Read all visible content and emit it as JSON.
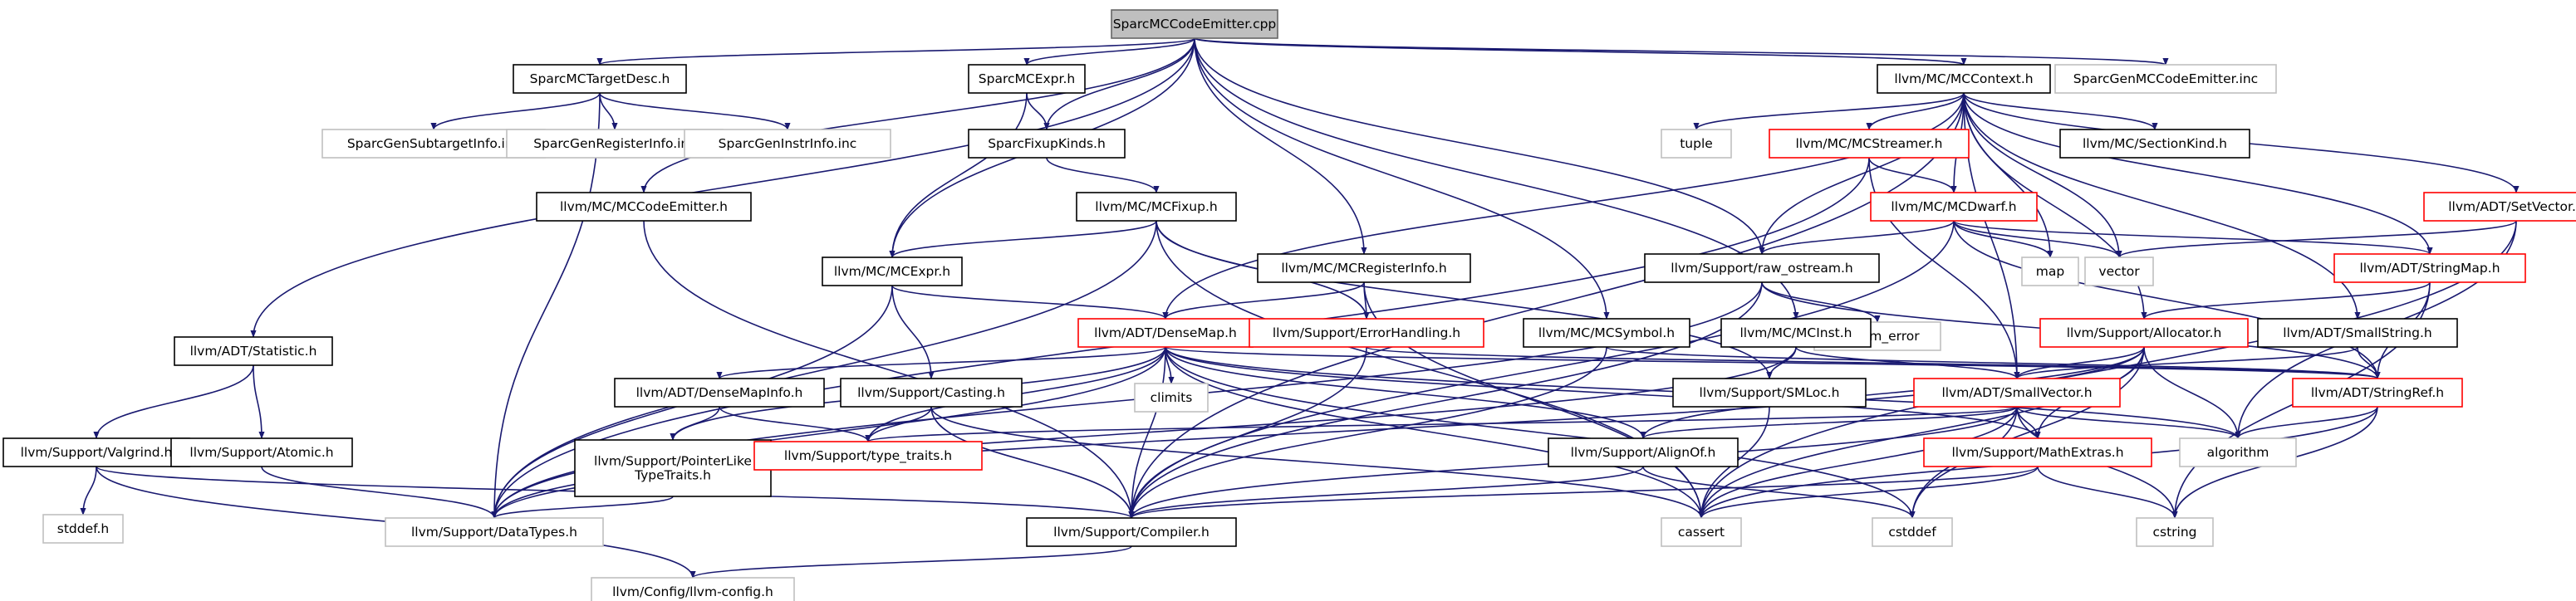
{
  "diagram": {
    "colors": {
      "edge": "#191970",
      "edge_external": "#9a9a9a",
      "border_root": "#666666",
      "fill_root": "#bfbfbf",
      "border_normal": "#000000",
      "border_incomplete": "#ff0000",
      "border_external": "#bfbfbf"
    },
    "nodes": [
      {
        "id": "root",
        "label": "SparcMCCodeEmitter.cpp",
        "kind": "root"
      },
      {
        "id": "targetdesc",
        "label": "SparcMCTargetDesc.h",
        "kind": "normal"
      },
      {
        "id": "sparcexpr",
        "label": "SparcMCExpr.h",
        "kind": "normal"
      },
      {
        "id": "mccontext",
        "label": "llvm/MC/MCContext.h",
        "kind": "normal"
      },
      {
        "id": "gencodeemitter",
        "label": "SparcGenMCCodeEmitter.inc",
        "kind": "external"
      },
      {
        "id": "gensubtarget",
        "label": "SparcGenSubtargetInfo.inc",
        "kind": "external"
      },
      {
        "id": "genregister",
        "label": "SparcGenRegisterInfo.inc",
        "kind": "external"
      },
      {
        "id": "geninstr",
        "label": "SparcGenInstrInfo.inc",
        "kind": "external"
      },
      {
        "id": "fixupkinds",
        "label": "SparcFixupKinds.h",
        "kind": "normal"
      },
      {
        "id": "tuple",
        "label": "tuple",
        "kind": "external"
      },
      {
        "id": "mcstreamer",
        "label": "llvm/MC/MCStreamer.h",
        "kind": "incomplete"
      },
      {
        "id": "sectionkind",
        "label": "llvm/MC/SectionKind.h",
        "kind": "normal"
      },
      {
        "id": "setvector",
        "label": "llvm/ADT/SetVector.h",
        "kind": "incomplete"
      },
      {
        "id": "mccodeemitter",
        "label": "llvm/MC/MCCodeEmitter.h",
        "kind": "normal"
      },
      {
        "id": "mcfixup",
        "label": "llvm/MC/MCFixup.h",
        "kind": "normal"
      },
      {
        "id": "mcdwarf",
        "label": "llvm/MC/MCDwarf.h",
        "kind": "incomplete"
      },
      {
        "id": "map",
        "label": "map",
        "kind": "external"
      },
      {
        "id": "vector",
        "label": "vector",
        "kind": "external"
      },
      {
        "id": "stringmap",
        "label": "llvm/ADT/StringMap.h",
        "kind": "incomplete"
      },
      {
        "id": "mcexpr",
        "label": "llvm/MC/MCExpr.h",
        "kind": "normal"
      },
      {
        "id": "mcregisterinfo",
        "label": "llvm/MC/MCRegisterInfo.h",
        "kind": "normal"
      },
      {
        "id": "raw_ostream",
        "label": "llvm/Support/raw_ostream.h",
        "kind": "normal"
      },
      {
        "id": "system_error",
        "label": "system_error",
        "kind": "external"
      },
      {
        "id": "densemap",
        "label": "llvm/ADT/DenseMap.h",
        "kind": "incomplete"
      },
      {
        "id": "errorhandling",
        "label": "llvm/Support/ErrorHandling.h",
        "kind": "incomplete"
      },
      {
        "id": "mcsymbol",
        "label": "llvm/MC/MCSymbol.h",
        "kind": "normal"
      },
      {
        "id": "mcinst",
        "label": "llvm/MC/MCInst.h",
        "kind": "normal"
      },
      {
        "id": "allocator",
        "label": "llvm/Support/Allocator.h",
        "kind": "incomplete"
      },
      {
        "id": "smallstring",
        "label": "llvm/ADT/SmallString.h",
        "kind": "normal"
      },
      {
        "id": "statistic",
        "label": "llvm/ADT/Statistic.h",
        "kind": "normal"
      },
      {
        "id": "densemapinfo",
        "label": "llvm/ADT/DenseMapInfo.h",
        "kind": "normal"
      },
      {
        "id": "climits",
        "label": "climits",
        "kind": "external"
      },
      {
        "id": "casting",
        "label": "llvm/Support/Casting.h",
        "kind": "normal"
      },
      {
        "id": "smloc",
        "label": "llvm/Support/SMLoc.h",
        "kind": "normal"
      },
      {
        "id": "smallvector",
        "label": "llvm/ADT/SmallVector.h",
        "kind": "incomplete"
      },
      {
        "id": "stringref",
        "label": "llvm/ADT/StringRef.h",
        "kind": "incomplete"
      },
      {
        "id": "valgrind",
        "label": "llvm/Support/Valgrind.h",
        "kind": "normal"
      },
      {
        "id": "atomic",
        "label": "llvm/Support/Atomic.h",
        "kind": "normal"
      },
      {
        "id": "pointerlike",
        "label": "llvm/Support/PointerLike\nTypeTraits.h",
        "kind": "normal"
      },
      {
        "id": "typetraits",
        "label": "llvm/Support/type_traits.h",
        "kind": "incomplete"
      },
      {
        "id": "alignof",
        "label": "llvm/Support/AlignOf.h",
        "kind": "normal"
      },
      {
        "id": "mathextras",
        "label": "llvm/Support/MathExtras.h",
        "kind": "incomplete"
      },
      {
        "id": "algorithm",
        "label": "algorithm",
        "kind": "external"
      },
      {
        "id": "stddef",
        "label": "stddef.h",
        "kind": "external"
      },
      {
        "id": "datatypes",
        "label": "llvm/Support/DataTypes.h",
        "kind": "external"
      },
      {
        "id": "compiler",
        "label": "llvm/Support/Compiler.h",
        "kind": "normal"
      },
      {
        "id": "cassert",
        "label": "cassert",
        "kind": "external"
      },
      {
        "id": "cstddef",
        "label": "cstddef",
        "kind": "external"
      },
      {
        "id": "cstring",
        "label": "cstring",
        "kind": "external"
      },
      {
        "id": "llvmconfig",
        "label": "llvm/Config/llvm-config.h",
        "kind": "external"
      }
    ],
    "edges": [
      [
        "root",
        "targetdesc"
      ],
      [
        "root",
        "sparcexpr"
      ],
      [
        "root",
        "mccontext"
      ],
      [
        "root",
        "gencodeemitter"
      ],
      [
        "root",
        "fixupkinds"
      ],
      [
        "root",
        "mccodeemitter"
      ],
      [
        "root",
        "mcexpr"
      ],
      [
        "root",
        "mcregisterinfo"
      ],
      [
        "root",
        "raw_ostream"
      ],
      [
        "root",
        "mcsymbol"
      ],
      [
        "root",
        "mcinst"
      ],
      [
        "root",
        "statistic"
      ],
      [
        "targetdesc",
        "gensubtarget"
      ],
      [
        "targetdesc",
        "genregister"
      ],
      [
        "targetdesc",
        "geninstr"
      ],
      [
        "targetdesc",
        "datatypes"
      ],
      [
        "sparcexpr",
        "fixupkinds"
      ],
      [
        "sparcexpr",
        "mcexpr"
      ],
      [
        "fixupkinds",
        "mcfixup"
      ],
      [
        "mccontext",
        "tuple"
      ],
      [
        "mccontext",
        "mcstreamer"
      ],
      [
        "mccontext",
        "sectionkind"
      ],
      [
        "mccontext",
        "setvector"
      ],
      [
        "mccontext",
        "mcdwarf"
      ],
      [
        "mccontext",
        "map"
      ],
      [
        "mccontext",
        "vector"
      ],
      [
        "mccontext",
        "stringmap"
      ],
      [
        "mccontext",
        "raw_ostream"
      ],
      [
        "mccontext",
        "densemap"
      ],
      [
        "mccontext",
        "allocator"
      ],
      [
        "mccontext",
        "smallstring"
      ],
      [
        "mccontext",
        "smallvector"
      ],
      [
        "mccontext",
        "compiler"
      ],
      [
        "mcstreamer",
        "mcdwarf"
      ],
      [
        "mcstreamer",
        "smallvector"
      ],
      [
        "mcstreamer",
        "datatypes"
      ],
      [
        "setvector",
        "vector"
      ],
      [
        "setvector",
        "algorithm"
      ],
      [
        "setvector",
        "cassert"
      ],
      [
        "mccodeemitter",
        "compiler"
      ],
      [
        "mcfixup",
        "mcexpr"
      ],
      [
        "mcfixup",
        "errorhandling"
      ],
      [
        "mcfixup",
        "smloc"
      ],
      [
        "mcfixup",
        "datatypes"
      ],
      [
        "mcfixup",
        "cassert"
      ],
      [
        "mcdwarf",
        "map"
      ],
      [
        "mcdwarf",
        "vector"
      ],
      [
        "mcdwarf",
        "raw_ostream"
      ],
      [
        "mcdwarf",
        "stringref"
      ],
      [
        "mcdwarf",
        "compiler"
      ],
      [
        "mcdwarf",
        "stringmap"
      ],
      [
        "stringmap",
        "allocator"
      ],
      [
        "stringmap",
        "stringref"
      ],
      [
        "stringmap",
        "cstring"
      ],
      [
        "mcexpr",
        "densemap"
      ],
      [
        "mcexpr",
        "casting"
      ],
      [
        "mcexpr",
        "datatypes"
      ],
      [
        "mcregisterinfo",
        "densemap"
      ],
      [
        "mcregisterinfo",
        "errorhandling"
      ],
      [
        "mcregisterinfo",
        "cassert"
      ],
      [
        "raw_ostream",
        "stringref"
      ],
      [
        "raw_ostream",
        "system_error"
      ],
      [
        "raw_ostream",
        "compiler"
      ],
      [
        "raw_ostream",
        "datatypes"
      ],
      [
        "densemap",
        "densemapinfo"
      ],
      [
        "densemap",
        "climits"
      ],
      [
        "densemap",
        "pointerlike"
      ],
      [
        "densemap",
        "typetraits"
      ],
      [
        "densemap",
        "alignof"
      ],
      [
        "densemap",
        "mathextras"
      ],
      [
        "densemap",
        "algorithm"
      ],
      [
        "densemap",
        "cassert"
      ],
      [
        "densemap",
        "cstddef"
      ],
      [
        "densemap",
        "compiler"
      ],
      [
        "densemap",
        "datatypes"
      ],
      [
        "densemap",
        "stringref"
      ],
      [
        "errorhandling",
        "stringref"
      ],
      [
        "errorhandling",
        "compiler"
      ],
      [
        "mcsymbol",
        "stringref"
      ],
      [
        "mcsymbol",
        "compiler"
      ],
      [
        "mcinst",
        "smallvector"
      ],
      [
        "mcinst",
        "smloc"
      ],
      [
        "mcinst",
        "datatypes"
      ],
      [
        "allocator",
        "smallvector"
      ],
      [
        "allocator",
        "alignof"
      ],
      [
        "allocator",
        "mathextras"
      ],
      [
        "allocator",
        "algorithm"
      ],
      [
        "allocator",
        "cassert"
      ],
      [
        "allocator",
        "cstddef"
      ],
      [
        "allocator",
        "datatypes"
      ],
      [
        "smallstring",
        "smallvector"
      ],
      [
        "smallstring",
        "stringref"
      ],
      [
        "statistic",
        "valgrind"
      ],
      [
        "statistic",
        "atomic"
      ],
      [
        "densemapinfo",
        "pointerlike"
      ],
      [
        "densemapinfo",
        "typetraits"
      ],
      [
        "casting",
        "typetraits"
      ],
      [
        "casting",
        "compiler"
      ],
      [
        "casting",
        "cassert"
      ],
      [
        "smloc",
        "cassert"
      ],
      [
        "smallvector",
        "alignof"
      ],
      [
        "smallvector",
        "mathextras"
      ],
      [
        "smallvector",
        "typetraits"
      ],
      [
        "smallvector",
        "algorithm"
      ],
      [
        "smallvector",
        "cassert"
      ],
      [
        "smallvector",
        "cstddef"
      ],
      [
        "smallvector",
        "cstring"
      ],
      [
        "smallvector",
        "compiler"
      ],
      [
        "stringref",
        "algorithm"
      ],
      [
        "stringref",
        "cassert"
      ],
      [
        "stringref",
        "cstring"
      ],
      [
        "valgrind",
        "stddef"
      ],
      [
        "valgrind",
        "compiler"
      ],
      [
        "valgrind",
        "llvmconfig"
      ],
      [
        "atomic",
        "datatypes"
      ],
      [
        "pointerlike",
        "datatypes"
      ],
      [
        "alignof",
        "compiler"
      ],
      [
        "alignof",
        "cstddef"
      ],
      [
        "mathextras",
        "compiler"
      ],
      [
        "mathextras",
        "cassert"
      ],
      [
        "mathextras",
        "cstring"
      ],
      [
        "compiler",
        "llvmconfig"
      ]
    ]
  }
}
